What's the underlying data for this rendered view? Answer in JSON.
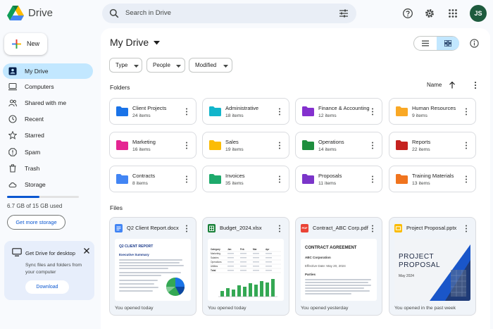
{
  "app": {
    "title": "Drive"
  },
  "search": {
    "placeholder": "Search in Drive"
  },
  "header": {
    "avatar_initials": "JS"
  },
  "new_button": {
    "label": "New"
  },
  "sidebar": {
    "items": [
      {
        "label": "My Drive",
        "icon": "my-drive-icon",
        "active": true
      },
      {
        "label": "Computers",
        "icon": "computer-icon"
      },
      {
        "label": "Shared with me",
        "icon": "people-icon"
      },
      {
        "label": "Recent",
        "icon": "clock-icon"
      },
      {
        "label": "Starred",
        "icon": "star-icon"
      },
      {
        "label": "Spam",
        "icon": "spam-icon"
      },
      {
        "label": "Trash",
        "icon": "trash-icon"
      },
      {
        "label": "Storage",
        "icon": "cloud-icon"
      }
    ],
    "storage": {
      "used_text": "6.7 GB of 15 GB used",
      "used_fraction": 0.45,
      "button": "Get more storage"
    },
    "promo": {
      "title": "Get Drive for desktop",
      "body": "Sync files and folders from your computer",
      "button": "Download"
    }
  },
  "main": {
    "title": "My Drive",
    "filters": [
      "Type",
      "People",
      "Modified"
    ],
    "folders_label": "Folders",
    "files_label": "Files",
    "sort_label": "Name",
    "folders": [
      {
        "name": "Client Projects",
        "count": "24 items",
        "color": "#1a73e8"
      },
      {
        "name": "Administrative",
        "count": "18 items",
        "color": "#12b5cb"
      },
      {
        "name": "Finance & Accounting",
        "count": "12 items",
        "color": "#8430ce"
      },
      {
        "name": "Human Resources",
        "count": "9 items",
        "color": "#f9a825"
      },
      {
        "name": "Marketing",
        "count": "16 items",
        "color": "#e52592"
      },
      {
        "name": "Sales",
        "count": "19 items",
        "color": "#fbbc04"
      },
      {
        "name": "Operations",
        "count": "14 items",
        "color": "#1e8e3e"
      },
      {
        "name": "Reports",
        "count": "22 items",
        "color": "#c5221f"
      },
      {
        "name": "Contracts",
        "count": "8 items",
        "color": "#4285f4"
      },
      {
        "name": "Invoices",
        "count": "35 items",
        "color": "#1eaa6c"
      },
      {
        "name": "Proposals",
        "count": "11 items",
        "color": "#7b35c9"
      },
      {
        "name": "Training Materials",
        "count": "13 items",
        "color": "#f0741e"
      }
    ],
    "files": [
      {
        "name": "Q2 Client Report.docx",
        "footer": "You opened today",
        "type": "doc",
        "thumb": {
          "title": "Q2 CLIENT REPORT",
          "subtitle": "Executive Summary"
        }
      },
      {
        "name": "Budget_2024.xlsx",
        "footer": "You opened today",
        "type": "sheet",
        "thumb": {
          "rows": [
            "Category",
            "Marketing",
            "Salaries",
            "Operations",
            "Utilities",
            "Total"
          ],
          "cols": [
            "Jan",
            "Feb",
            "Mar",
            "Apr"
          ]
        }
      },
      {
        "name": "Contract_ABC Corp.pdf",
        "footer": "You opened yesterday",
        "type": "pdf",
        "thumb": {
          "title": "CONTRACT AGREEMENT",
          "party": "ABC Corporation",
          "date": "Effective Date: May 20, 2024",
          "section": "Parties"
        }
      },
      {
        "name": "Project Proposal.pptx",
        "footer": "You opened in the past week",
        "type": "slides",
        "thumb": {
          "title_line1": "PROJECT",
          "title_line2": "PROPOSAL",
          "date": "May 2024"
        }
      }
    ]
  }
}
